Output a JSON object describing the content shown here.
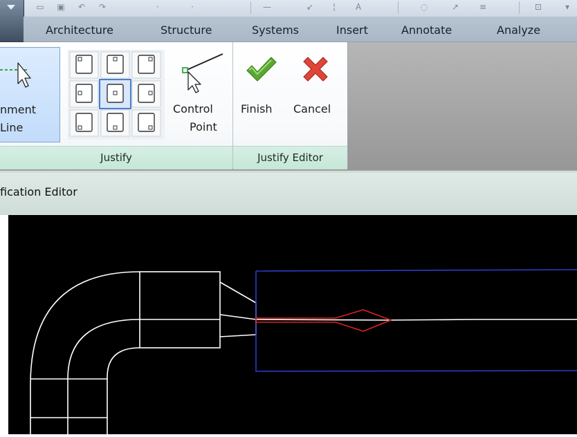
{
  "ribbon_tabs": [
    "Architecture",
    "Structure",
    "Systems",
    "Insert",
    "Annotate",
    "Analyze"
  ],
  "justify_panel": {
    "alignment_line_label_1": "nment",
    "alignment_line_label_2": "Line",
    "control_point_label_1": "Control",
    "control_point_label_2": "Point",
    "title": "Justify"
  },
  "justify_editor_panel": {
    "finish_label": "Finish",
    "cancel_label": "Cancel",
    "title": "Justify Editor"
  },
  "context_bar": {
    "title": "fication Editor"
  },
  "colors": {
    "finish_check": "#5aa832",
    "cancel_x": "#e0453a",
    "canvas_background": "#000000",
    "duct_lines": "#ffffff",
    "selection_box": "#2a3cc8",
    "direction_arrow": "#e02020"
  },
  "icons": {
    "alignment_line": "cursor-with-dashed-line-icon",
    "justify_grid": "justification-grid-icons",
    "control_point": "cursor-with-line-icon",
    "finish": "green-checkmark-icon",
    "cancel": "red-x-icon"
  }
}
